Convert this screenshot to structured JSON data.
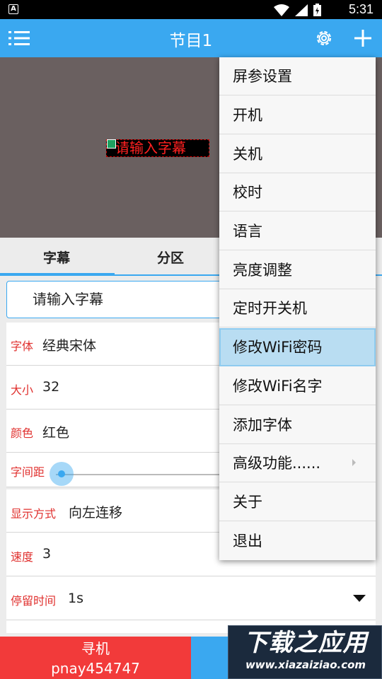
{
  "status_bar": {
    "time": "5:31",
    "app_badge": "A"
  },
  "app_bar": {
    "title": "节目1"
  },
  "preview": {
    "marquee_text": "请输入字幕"
  },
  "tabs": [
    {
      "label": "字幕"
    },
    {
      "label": "分区"
    }
  ],
  "caption_input": {
    "value": "请输入字幕"
  },
  "settings": {
    "font": {
      "label": "字体",
      "value": "经典宋体"
    },
    "size": {
      "label": "大小",
      "value": "32"
    },
    "color": {
      "label": "颜色",
      "value": "红色"
    },
    "spacing": {
      "label": "字间距"
    },
    "display_mode": {
      "label": "显示方式",
      "value": "向左连移"
    },
    "speed": {
      "label": "速度",
      "value": "3"
    },
    "dwell": {
      "label": "停留时间",
      "value": "1s"
    }
  },
  "bottom": {
    "find_label": "寻机",
    "device_id": "pnay454747"
  },
  "watermark": {
    "big": "下载之应用",
    "small": "www.xiazaiziao.com"
  },
  "menu": {
    "items": [
      {
        "label": "屏参设置"
      },
      {
        "label": "开机"
      },
      {
        "label": "关机"
      },
      {
        "label": "校时"
      },
      {
        "label": "语言"
      },
      {
        "label": "亮度调整"
      },
      {
        "label": "定时开关机"
      },
      {
        "label": "修改WiFi密码",
        "highlighted": true
      },
      {
        "label": "修改WiFi名字"
      },
      {
        "label": "添加字体"
      },
      {
        "label": "高级功能......",
        "has_submenu": true
      },
      {
        "label": "关于"
      },
      {
        "label": "退出"
      }
    ]
  },
  "colors": {
    "primary": "#3aa8f0",
    "danger": "#f23a3a",
    "label_red": "#e0302e"
  }
}
